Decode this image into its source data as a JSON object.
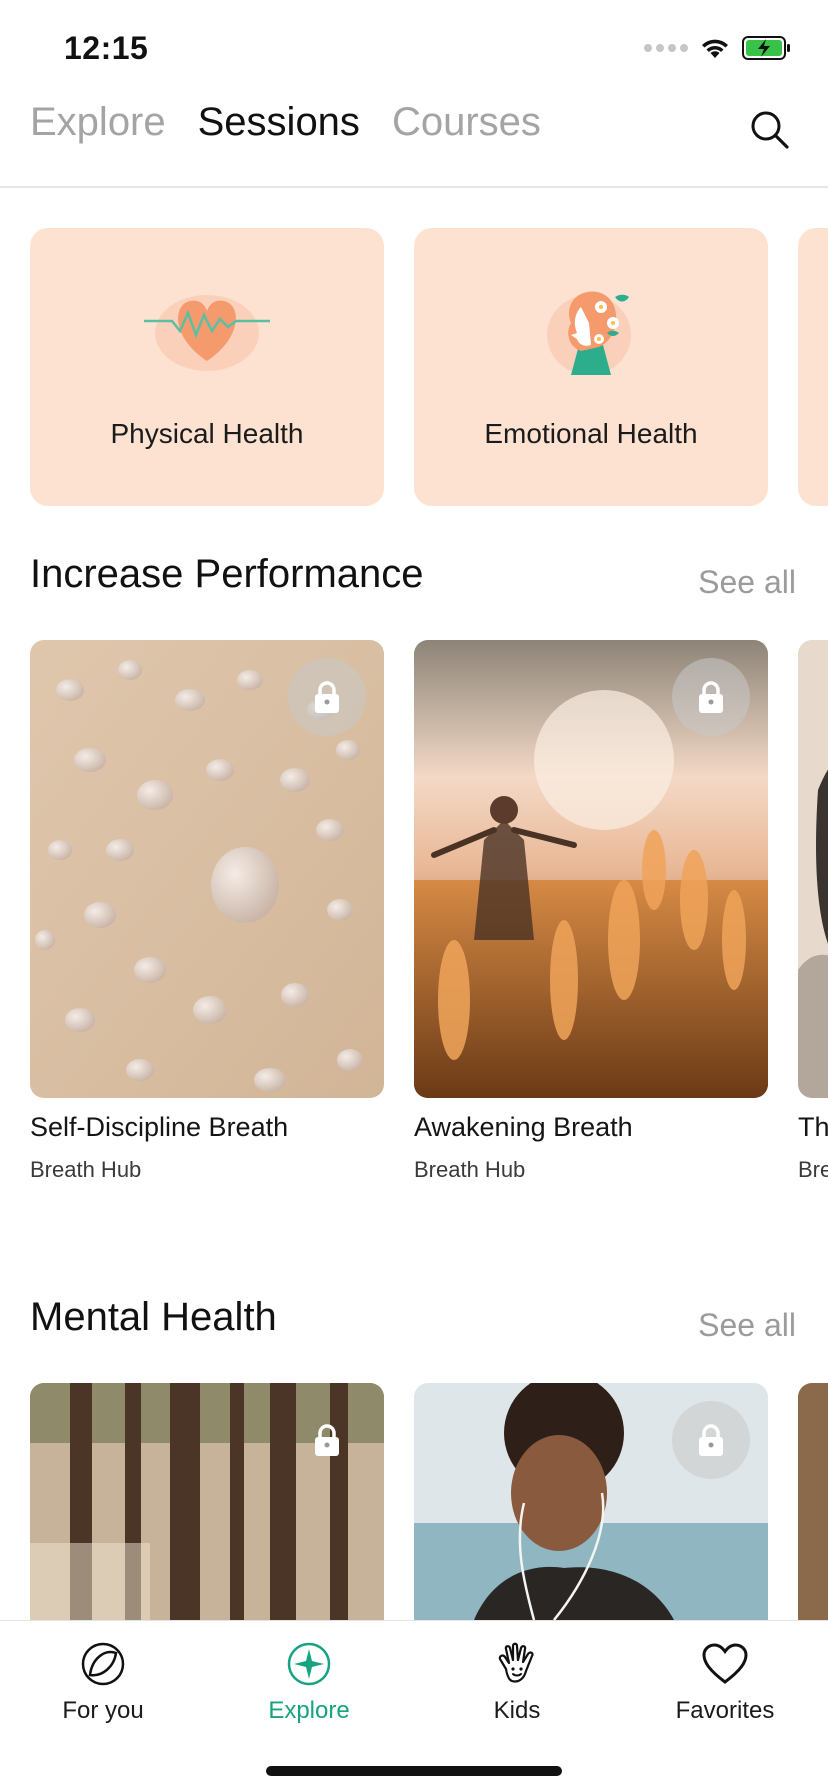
{
  "status_bar": {
    "time": "12:15"
  },
  "top_tabs": [
    {
      "label": "Explore",
      "active": false
    },
    {
      "label": "Sessions",
      "active": true
    },
    {
      "label": "Courses",
      "active": false
    }
  ],
  "categories": [
    {
      "label": "Physical Health",
      "icon": "heart-pulse-icon"
    },
    {
      "label": "Emotional Health",
      "icon": "woman-flowers-icon"
    },
    {
      "label": ""
    }
  ],
  "sections": [
    {
      "title": "Increase Performance",
      "see_all": "See all",
      "items": [
        {
          "title": "Self-Discipline Breath",
          "subtitle": "Breath Hub",
          "locked": true
        },
        {
          "title": "Awakening Breath",
          "subtitle": "Breath Hub",
          "locked": true
        },
        {
          "title": "Th",
          "subtitle": "Bre",
          "locked": false
        }
      ]
    },
    {
      "title": "Mental Health",
      "see_all": "See all",
      "items": [
        {
          "title": "",
          "subtitle": "",
          "locked": true
        },
        {
          "title": "",
          "subtitle": "",
          "locked": true
        },
        {
          "title": "",
          "subtitle": "",
          "locked": false
        }
      ]
    }
  ],
  "bottom_nav": [
    {
      "label": "For you",
      "icon": "for-you-icon",
      "active": false
    },
    {
      "label": "Explore",
      "icon": "explore-star-icon",
      "active": true
    },
    {
      "label": "Kids",
      "icon": "hand-icon",
      "active": false
    },
    {
      "label": "Favorites",
      "icon": "heart-icon",
      "active": false
    }
  ],
  "colors": {
    "accent": "#17a381",
    "card_peach": "#fde2d2",
    "muted_text": "#a4a4a4"
  }
}
